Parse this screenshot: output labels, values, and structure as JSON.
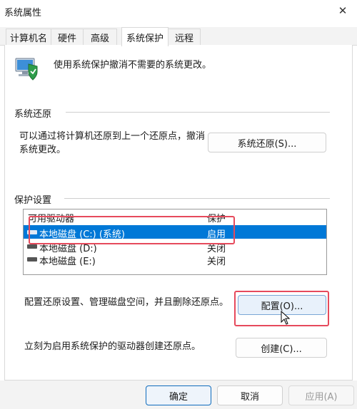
{
  "window": {
    "title": "系统属性",
    "close_glyph": "✕"
  },
  "tabs": [
    {
      "label": "计算机名"
    },
    {
      "label": "硬件"
    },
    {
      "label": "高级"
    },
    {
      "label": "系统保护",
      "active": true
    },
    {
      "label": "远程"
    }
  ],
  "intro": {
    "text": "使用系统保护撤消不需要的系统更改。",
    "icon": "system-protection-shield-icon"
  },
  "restore_section": {
    "title": "系统还原",
    "line1": "可以通过将计算机还原到上一个还原点，撤消",
    "line2": "系统更改。",
    "button": "系统还原(S)..."
  },
  "protection_section": {
    "title": "保护设置",
    "columns": {
      "drive": "可用驱动器",
      "protection": "保护"
    },
    "drives": [
      {
        "name": "本地磁盘 (C:) (系统)",
        "protection": "启用",
        "selected": true
      },
      {
        "name": "本地磁盘 (D:)",
        "protection": "关闭",
        "selected": false
      },
      {
        "name": "本地磁盘 (E:)",
        "protection": "关闭",
        "selected": false
      }
    ],
    "configure_text": "配置还原设置、管理磁盘空间，并且删除还原点。",
    "configure_button": "配置(O)...",
    "create_text": "立刻为启用系统保护的驱动器创建还原点。",
    "create_button": "创建(C)..."
  },
  "footer": {
    "ok": "确定",
    "cancel": "取消",
    "apply": "应用(A)"
  },
  "colors": {
    "selection": "#0078d7",
    "annotation": "#e64a5c",
    "accent": "#0f6cbd"
  }
}
